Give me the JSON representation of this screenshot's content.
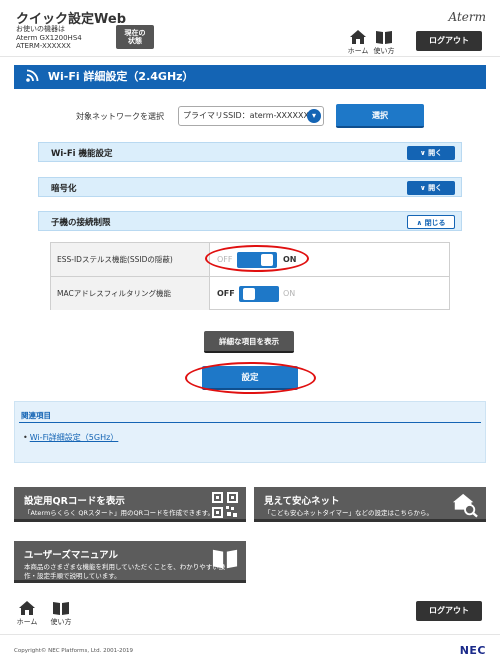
{
  "header": {
    "app_title": "クイック設定Web",
    "device_line1": "お使いの機器は",
    "device_line2": "Aterm GX1200HS4",
    "device_line3": "ATERM-XXXXXX",
    "status_line1": "現在の",
    "status_line2": "状態",
    "brand": "Aterm",
    "home_label": "ホーム",
    "help_label": "使い方",
    "logout_label": "ログアウト"
  },
  "page": {
    "title": "Wi-Fi 詳細設定（2.4GHz）"
  },
  "network": {
    "label": "対象ネットワークを選択",
    "selected": "プライマリSSID：aterm-XXXXXX-g",
    "select_button": "選択"
  },
  "sections": [
    {
      "title": "Wi-Fi 機能設定",
      "button": "開く",
      "expanded": false
    },
    {
      "title": "暗号化",
      "button": "開く",
      "expanded": false
    },
    {
      "title": "子機の接続制限",
      "button": "閉じる",
      "expanded": true
    }
  ],
  "settings": [
    {
      "label": "ESS-IDステルス機能(SSIDの隠蔽)",
      "off": "OFF",
      "on": "ON",
      "state": "ON"
    },
    {
      "label": "MACアドレスフィルタリング機能",
      "off": "OFF",
      "on": "ON",
      "state": "OFF"
    }
  ],
  "buttons": {
    "detail": "詳細な項目を表示",
    "apply": "設定"
  },
  "related": {
    "title": "関連項目",
    "link": "Wi-Fi詳細設定（5GHz）"
  },
  "tiles": {
    "qr_title": "設定用QRコードを表示",
    "qr_desc": "「Atermらくらく QRスタート」用のQRコードを作成できます。",
    "safety_title": "見えて安心ネット",
    "safety_desc": "「こども安心ネットタイマー」などの設定はこちらから。",
    "manual_title": "ユーザーズマニュアル",
    "manual_desc_line1": "本商品のさまざまな機能を利用していただくことを、わかりやすい操",
    "manual_desc_line2": "作・設定手順で説明しています。"
  },
  "footer": {
    "home_label": "ホーム",
    "help_label": "使い方",
    "logout_label": "ログアウト",
    "copyright": "Copyright© NEC Platforms, Ltd. 2001-2019",
    "nec": "NEC"
  },
  "colors": {
    "accent": "#1464b4",
    "button_blue": "#1e78c8",
    "highlight": "#e01010",
    "accordion_bg": "#dbeefb"
  }
}
